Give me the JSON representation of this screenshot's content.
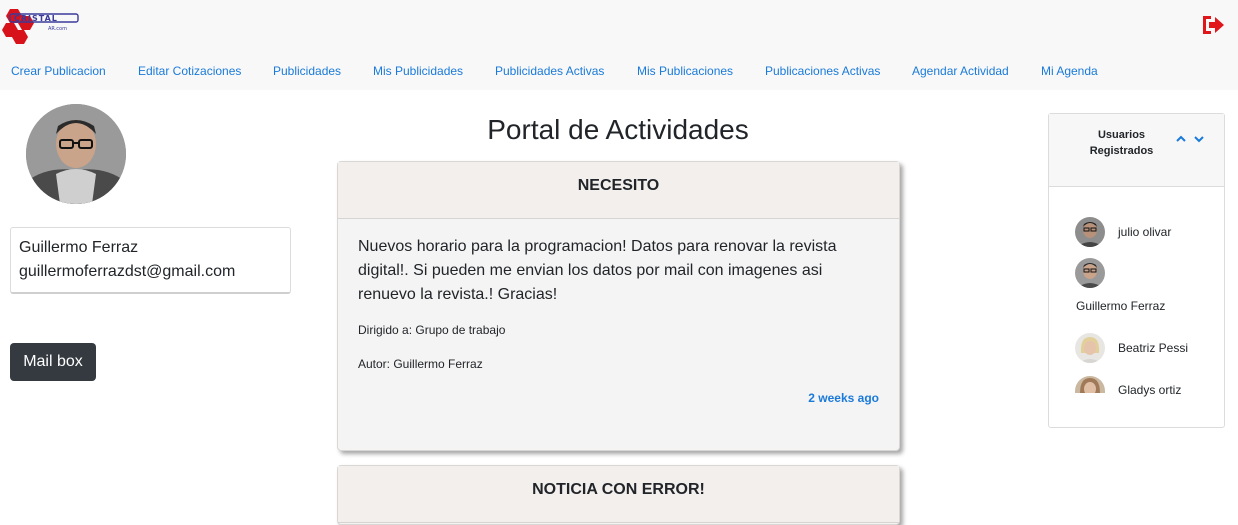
{
  "header": {
    "logo_text": "CRISTAL",
    "logo_subtext": "AR.com"
  },
  "nav": {
    "items": [
      {
        "label": "Crear Publicacion"
      },
      {
        "label": "Editar Cotizaciones"
      },
      {
        "label": "Publicidades"
      },
      {
        "label": "Mis Publicidades"
      },
      {
        "label": "Publicidades Activas"
      },
      {
        "label": "Mis Publicaciones"
      },
      {
        "label": "Publicaciones Activas"
      },
      {
        "label": "Agendar Actividad"
      },
      {
        "label": "Mi Agenda"
      }
    ]
  },
  "profile": {
    "name": "Guillermo Ferraz",
    "email": "guillermoferrazdst@gmail.com",
    "mailbox_label": "Mail box"
  },
  "main": {
    "title": "Portal de Actividades",
    "posts": [
      {
        "heading": "NECESITO",
        "text": "Nuevos horario para la programacion! Datos para renovar la revista digital!. Si pueden me envian los datos por mail con imagenes asi renuevo la revista.! Gracias!",
        "recipient": "Dirigido a: Grupo de trabajo",
        "author": "Autor: Guillermo Ferraz",
        "time": "2 weeks ago"
      },
      {
        "heading": "NOTICIA CON ERROR!"
      }
    ]
  },
  "users_panel": {
    "title": "Usuarios Registrados",
    "users": [
      {
        "name": "julio olivar"
      },
      {
        "name": "Guillermo Ferraz"
      },
      {
        "name": "Beatriz Pessi"
      },
      {
        "name": "Gladys ortiz"
      }
    ]
  },
  "colors": {
    "link": "#1a7ad9",
    "logout": "#e0161b",
    "button_dark": "#343a40"
  },
  "icons": {
    "logout": "sign-out-icon",
    "collapse": "chevron-up-icon",
    "expand": "chevron-down-icon"
  }
}
